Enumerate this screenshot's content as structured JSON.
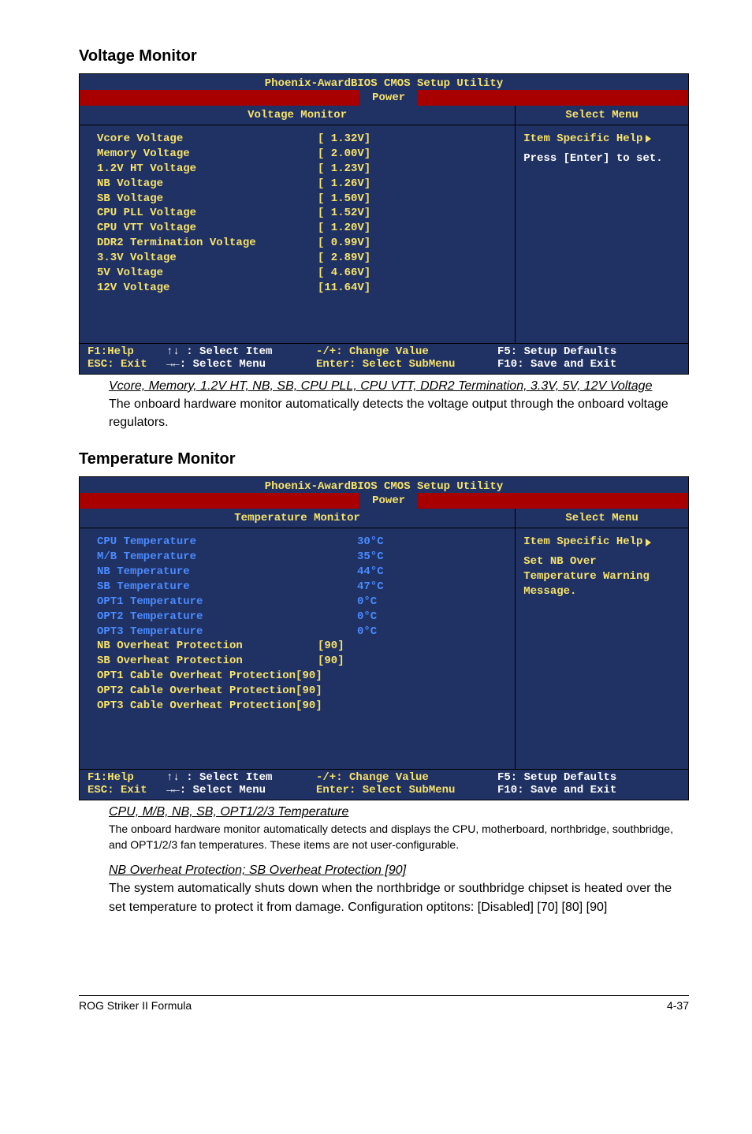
{
  "section1_title": "Voltage Monitor",
  "section2_title": "Temperature Monitor",
  "bios_common": {
    "title": "Phoenix-AwardBIOS CMOS Setup Utility",
    "tab": "Power",
    "select_menu": "Select Menu",
    "help_hdr": "Item Specific Help",
    "foot_f1": "F1:Help",
    "foot_esc": "ESC: Exit",
    "foot_updown": "↑↓ : Select Item",
    "foot_lr": "→←: Select Menu",
    "foot_change": "-/+: Change Value",
    "foot_enter": "Enter: Select SubMenu",
    "foot_f5": "F5: Setup Defaults",
    "foot_f10": "F10: Save and Exit"
  },
  "voltage_bios": {
    "left_title": "Voltage Monitor",
    "help_text": "Press [Enter] to set.",
    "rows": [
      {
        "l": "Vcore Voltage",
        "v": "[ 1.32V]",
        "c": "yellow"
      },
      {
        "l": "Memory Voltage",
        "v": "[ 2.00V]",
        "c": "yellow"
      },
      {
        "l": "1.2V HT Voltage",
        "v": "[ 1.23V]",
        "c": "yellow"
      },
      {
        "l": "NB Voltage",
        "v": "[ 1.26V]",
        "c": "yellow"
      },
      {
        "l": "SB Voltage",
        "v": "[ 1.50V]",
        "c": "yellow"
      },
      {
        "l": "CPU PLL Voltage",
        "v": "[ 1.52V]",
        "c": "yellow"
      },
      {
        "l": "CPU VTT Voltage",
        "v": "[ 1.20V]",
        "c": "yellow"
      },
      {
        "l": "DDR2 Termination Voltage",
        "v": "[ 0.99V]",
        "c": "yellow"
      },
      {
        "l": "3.3V Voltage",
        "v": "[ 2.89V]",
        "c": "yellow"
      },
      {
        "l": "5V Voltage",
        "v": "[ 4.66V]",
        "c": "yellow"
      },
      {
        "l": "12V Voltage",
        "v": "[11.64V]",
        "c": "yellow"
      }
    ]
  },
  "voltage_link": "Vcore, Memory, 1.2V HT, NB, SB, CPU PLL, CPU VTT, DDR2 Termination, 3.3V, 5V, 12V Voltage",
  "voltage_body": "The onboard hardware monitor automatically detects the voltage output through the onboard voltage regulators.",
  "temp_bios": {
    "left_title": "Temperature Monitor",
    "help_l1": "Set NB Over",
    "help_l2": "Temperature Warning",
    "help_l3": "Message.",
    "rows": [
      {
        "l": "CPU Temperature",
        "v": "30°C",
        "c": "blue"
      },
      {
        "l": "M/B Temperature",
        "v": "35°C",
        "c": "blue"
      },
      {
        "l": "NB Temperature",
        "v": "44°C",
        "c": "blue"
      },
      {
        "l": "SB Temperature",
        "v": "47°C",
        "c": "blue"
      },
      {
        "l": "OPT1 Temperature",
        "v": "0°C",
        "c": "blue"
      },
      {
        "l": "OPT2 Temperature",
        "v": "0°C",
        "c": "blue"
      },
      {
        "l": "OPT3 Temperature",
        "v": "0°C",
        "c": "blue"
      },
      {
        "l": "NB Overheat Protection",
        "v": "[90]",
        "c": "yellow"
      },
      {
        "l": "SB Overheat Protection",
        "v": "[90]",
        "c": "yellow"
      },
      {
        "l": "OPT1 Cable Overheat Protection[90]",
        "v": "",
        "c": "yellow"
      },
      {
        "l": "OPT2 Cable Overheat Protection[90]",
        "v": "",
        "c": "yellow"
      },
      {
        "l": "OPT3 Cable Overheat Protection[90]",
        "v": "",
        "c": "yellow"
      }
    ]
  },
  "temp_link1": "CPU, M/B, NB, SB, OPT1/2/3 Temperature",
  "temp_body1": "The onboard hardware monitor automatically detects and displays the CPU, motherboard, northbridge, southbridge, and OPT1/2/3 fan temperatures. These items are not user-configurable.",
  "temp_link2": "NB Overheat Protection; SB Overheat Protection [90]",
  "temp_body2": "The system automatically shuts down when the northbridge or southbridge chipset is heated over the set temperature to protect it from damage. Configuration optitons: [Disabled] [70] [80] [90]",
  "footer_left": "ROG Striker II Formula",
  "footer_right": "4-37"
}
